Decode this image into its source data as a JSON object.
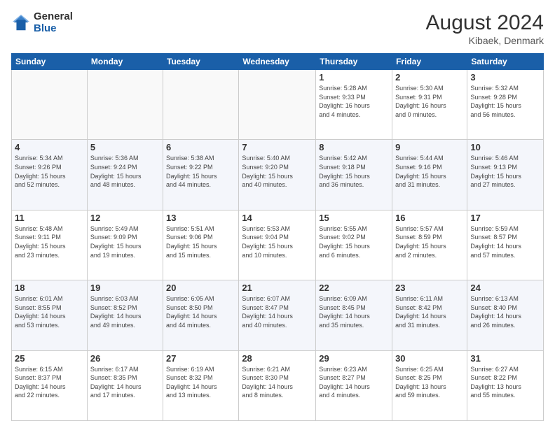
{
  "header": {
    "logo_general": "General",
    "logo_blue": "Blue",
    "month_title": "August 2024",
    "location": "Kibaek, Denmark"
  },
  "days_of_week": [
    "Sunday",
    "Monday",
    "Tuesday",
    "Wednesday",
    "Thursday",
    "Friday",
    "Saturday"
  ],
  "weeks": [
    [
      {
        "day": "",
        "info": ""
      },
      {
        "day": "",
        "info": ""
      },
      {
        "day": "",
        "info": ""
      },
      {
        "day": "",
        "info": ""
      },
      {
        "day": "1",
        "info": "Sunrise: 5:28 AM\nSunset: 9:33 PM\nDaylight: 16 hours\nand 4 minutes."
      },
      {
        "day": "2",
        "info": "Sunrise: 5:30 AM\nSunset: 9:31 PM\nDaylight: 16 hours\nand 0 minutes."
      },
      {
        "day": "3",
        "info": "Sunrise: 5:32 AM\nSunset: 9:28 PM\nDaylight: 15 hours\nand 56 minutes."
      }
    ],
    [
      {
        "day": "4",
        "info": "Sunrise: 5:34 AM\nSunset: 9:26 PM\nDaylight: 15 hours\nand 52 minutes."
      },
      {
        "day": "5",
        "info": "Sunrise: 5:36 AM\nSunset: 9:24 PM\nDaylight: 15 hours\nand 48 minutes."
      },
      {
        "day": "6",
        "info": "Sunrise: 5:38 AM\nSunset: 9:22 PM\nDaylight: 15 hours\nand 44 minutes."
      },
      {
        "day": "7",
        "info": "Sunrise: 5:40 AM\nSunset: 9:20 PM\nDaylight: 15 hours\nand 40 minutes."
      },
      {
        "day": "8",
        "info": "Sunrise: 5:42 AM\nSunset: 9:18 PM\nDaylight: 15 hours\nand 36 minutes."
      },
      {
        "day": "9",
        "info": "Sunrise: 5:44 AM\nSunset: 9:16 PM\nDaylight: 15 hours\nand 31 minutes."
      },
      {
        "day": "10",
        "info": "Sunrise: 5:46 AM\nSunset: 9:13 PM\nDaylight: 15 hours\nand 27 minutes."
      }
    ],
    [
      {
        "day": "11",
        "info": "Sunrise: 5:48 AM\nSunset: 9:11 PM\nDaylight: 15 hours\nand 23 minutes."
      },
      {
        "day": "12",
        "info": "Sunrise: 5:49 AM\nSunset: 9:09 PM\nDaylight: 15 hours\nand 19 minutes."
      },
      {
        "day": "13",
        "info": "Sunrise: 5:51 AM\nSunset: 9:06 PM\nDaylight: 15 hours\nand 15 minutes."
      },
      {
        "day": "14",
        "info": "Sunrise: 5:53 AM\nSunset: 9:04 PM\nDaylight: 15 hours\nand 10 minutes."
      },
      {
        "day": "15",
        "info": "Sunrise: 5:55 AM\nSunset: 9:02 PM\nDaylight: 15 hours\nand 6 minutes."
      },
      {
        "day": "16",
        "info": "Sunrise: 5:57 AM\nSunset: 8:59 PM\nDaylight: 15 hours\nand 2 minutes."
      },
      {
        "day": "17",
        "info": "Sunrise: 5:59 AM\nSunset: 8:57 PM\nDaylight: 14 hours\nand 57 minutes."
      }
    ],
    [
      {
        "day": "18",
        "info": "Sunrise: 6:01 AM\nSunset: 8:55 PM\nDaylight: 14 hours\nand 53 minutes."
      },
      {
        "day": "19",
        "info": "Sunrise: 6:03 AM\nSunset: 8:52 PM\nDaylight: 14 hours\nand 49 minutes."
      },
      {
        "day": "20",
        "info": "Sunrise: 6:05 AM\nSunset: 8:50 PM\nDaylight: 14 hours\nand 44 minutes."
      },
      {
        "day": "21",
        "info": "Sunrise: 6:07 AM\nSunset: 8:47 PM\nDaylight: 14 hours\nand 40 minutes."
      },
      {
        "day": "22",
        "info": "Sunrise: 6:09 AM\nSunset: 8:45 PM\nDaylight: 14 hours\nand 35 minutes."
      },
      {
        "day": "23",
        "info": "Sunrise: 6:11 AM\nSunset: 8:42 PM\nDaylight: 14 hours\nand 31 minutes."
      },
      {
        "day": "24",
        "info": "Sunrise: 6:13 AM\nSunset: 8:40 PM\nDaylight: 14 hours\nand 26 minutes."
      }
    ],
    [
      {
        "day": "25",
        "info": "Sunrise: 6:15 AM\nSunset: 8:37 PM\nDaylight: 14 hours\nand 22 minutes."
      },
      {
        "day": "26",
        "info": "Sunrise: 6:17 AM\nSunset: 8:35 PM\nDaylight: 14 hours\nand 17 minutes."
      },
      {
        "day": "27",
        "info": "Sunrise: 6:19 AM\nSunset: 8:32 PM\nDaylight: 14 hours\nand 13 minutes."
      },
      {
        "day": "28",
        "info": "Sunrise: 6:21 AM\nSunset: 8:30 PM\nDaylight: 14 hours\nand 8 minutes."
      },
      {
        "day": "29",
        "info": "Sunrise: 6:23 AM\nSunset: 8:27 PM\nDaylight: 14 hours\nand 4 minutes."
      },
      {
        "day": "30",
        "info": "Sunrise: 6:25 AM\nSunset: 8:25 PM\nDaylight: 13 hours\nand 59 minutes."
      },
      {
        "day": "31",
        "info": "Sunrise: 6:27 AM\nSunset: 8:22 PM\nDaylight: 13 hours\nand 55 minutes."
      }
    ]
  ]
}
